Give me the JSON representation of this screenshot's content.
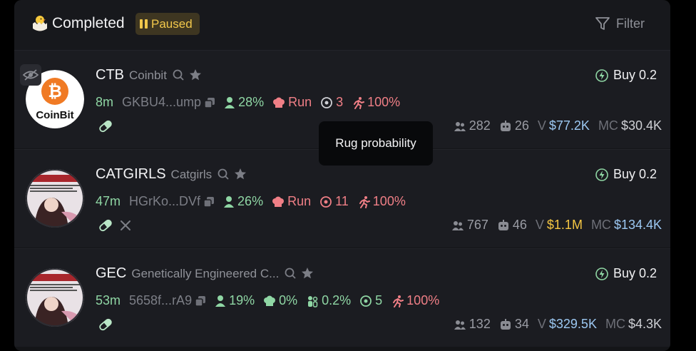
{
  "header": {
    "title": "Completed",
    "emoji_icon": "hatching-chick-icon",
    "paused_label": "Paused",
    "filter_label": "Filter"
  },
  "tooltip": {
    "text": "Rug probability"
  },
  "tokens": [
    {
      "ticker": "CTB",
      "name": "Coinbit",
      "age": "8m",
      "address": "GKBU4...ump",
      "holders_pct": "28%",
      "dev_status": "Run",
      "snipers": "3",
      "insiders_pct": "100%",
      "holders": "282",
      "bots": "26",
      "volume_label": "V",
      "volume": "$77.2K",
      "mc_label": "MC",
      "mc": "$30.4K",
      "buy_label": "Buy 0.2",
      "avatar_text": "CoinBit"
    },
    {
      "ticker": "CATGIRLS",
      "name": "Catgirls",
      "age": "47m",
      "address": "HGrKo...DVf",
      "holders_pct": "26%",
      "dev_status": "Run",
      "snipers": "11",
      "insiders_pct": "100%",
      "holders": "767",
      "bots": "46",
      "volume_label": "V",
      "volume": "$1.1M",
      "mc_label": "MC",
      "mc": "$134.4K",
      "buy_label": "Buy 0.2"
    },
    {
      "ticker": "GEC",
      "name": "Genetically Engineered C...",
      "age": "53m",
      "address": "5658f...rA9",
      "holders_pct": "19%",
      "dev_pct": "0%",
      "top10_pct": "0.2%",
      "snipers": "5",
      "insiders_pct": "100%",
      "holders": "132",
      "bots": "34",
      "volume_label": "V",
      "volume": "$329.5K",
      "mc_label": "MC",
      "mc": "$4.3K",
      "buy_label": "Buy 0.2"
    }
  ],
  "colors": {
    "accent_green": "#8fd6a4",
    "risk_pink": "#f07f86",
    "paused_yellow": "#f2c84b",
    "value_blue": "#9cc8f2",
    "value_yellow": "#f4c643"
  }
}
